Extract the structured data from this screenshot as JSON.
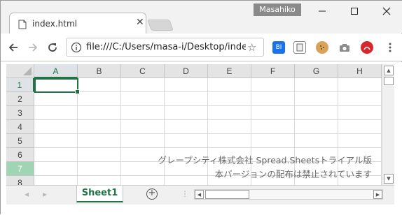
{
  "browser": {
    "profile_name": "Masahiko",
    "tab_title": "index.html",
    "url": "file:///C:/Users/masa-i/Desktop/inde",
    "extensions": [
      {
        "name": "bi-extension-icon",
        "label": "BI",
        "color": "#1a73e8"
      },
      {
        "name": "doc-extension-icon",
        "label": "",
        "color": "#6b6b6b"
      },
      {
        "name": "cookie-extension-icon",
        "label": "",
        "color": "#c78b3a"
      },
      {
        "name": "camera-extension-icon",
        "label": "",
        "color": "#8a8a8a"
      },
      {
        "name": "adobe-extension-icon",
        "label": "",
        "color": "#d9262c"
      }
    ]
  },
  "sheet": {
    "columns": [
      "A",
      "B",
      "C",
      "D",
      "E",
      "F",
      "G",
      "H"
    ],
    "rows": [
      "1",
      "2",
      "3",
      "4",
      "5",
      "6",
      "7",
      "8"
    ],
    "selected_column": "A",
    "selected_row": "1",
    "highlight_row": "7",
    "active_cell": "A1",
    "accent_color": "#217346",
    "watermark_line1": "グレープシティ株式会社 Spread.Sheetsトライアル版",
    "watermark_line2": "本バージョンの配布は禁止されています"
  },
  "tabs": {
    "sheets": [
      "Sheet1"
    ],
    "add_label": "+"
  }
}
